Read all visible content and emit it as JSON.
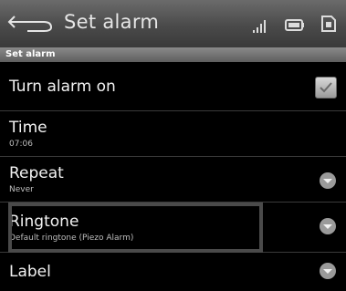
{
  "titlebar": {
    "title": "Set alarm"
  },
  "section": {
    "label": "Set alarm"
  },
  "rows": {
    "turn_on": {
      "title": "Turn alarm on",
      "checked": true
    },
    "time": {
      "title": "Time",
      "value": "07:06"
    },
    "repeat": {
      "title": "Repeat",
      "value": "Never"
    },
    "ringtone": {
      "title": "Ringtone",
      "value": "Default ringtone (Piezo Alarm)"
    },
    "label": {
      "title": "Label"
    }
  },
  "icons": {
    "back": "back-arrow-icon",
    "signal": "signal-strength-icon",
    "battery": "battery-icon",
    "sim": "sim-card-icon",
    "dropdown": "chevron-down-icon",
    "checkbox": "checkmark-icon"
  }
}
